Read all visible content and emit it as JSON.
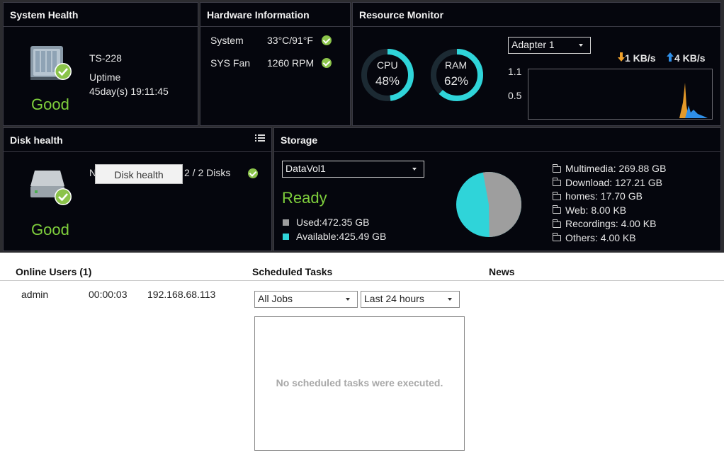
{
  "system_health": {
    "title": "System Health",
    "model": "TS-228",
    "uptime_label": "Uptime",
    "uptime_value": "45day(s) 19:11:45",
    "status": "Good"
  },
  "hardware_info": {
    "title": "Hardware Information",
    "rows": [
      {
        "label": "System",
        "value": "33°C/91°F"
      },
      {
        "label": "SYS Fan",
        "value": "1260 RPM"
      }
    ]
  },
  "resource_monitor": {
    "title": "Resource Monitor",
    "cpu_label": "CPU",
    "cpu_value": "48%",
    "cpu_percent": 48,
    "ram_label": "RAM",
    "ram_value": "62%",
    "ram_percent": 62,
    "adapter": "Adapter 1",
    "down_rate": "1 KB/s",
    "up_rate": "4 KB/s",
    "y_tick_top": "1.1",
    "y_tick_mid": "0.5"
  },
  "disk_health": {
    "title": "Disk health",
    "prefix": "N",
    "tooltip": "Disk health",
    "disks": "2 / 2 Disks",
    "status": "Good"
  },
  "storage": {
    "title": "Storage",
    "volume": "DataVol1",
    "status": "Ready",
    "used": "Used:472.35 GB",
    "available": "Available:425.49 GB",
    "used_gb": 472.35,
    "available_gb": 425.49,
    "folders": [
      "Multimedia: 269.88 GB",
      "Download: 127.21 GB",
      "homes: 17.70 GB",
      "Web: 8.00 KB",
      "Recordings: 4.00 KB",
      "Others: 4.00 KB"
    ]
  },
  "online_users": {
    "title": "Online Users (1)",
    "rows": [
      {
        "name": "admin",
        "duration": "00:00:03",
        "ip": "192.168.68.113"
      }
    ]
  },
  "scheduled_tasks": {
    "title": "Scheduled Tasks",
    "filter_jobs": "All Jobs",
    "filter_time": "Last 24 hours",
    "empty_message": "No scheduled tasks were executed."
  },
  "news": {
    "title": "News"
  },
  "colors": {
    "accent": "#2fd4d9",
    "good": "#7fcf3c",
    "used": "#9e9e9e"
  }
}
